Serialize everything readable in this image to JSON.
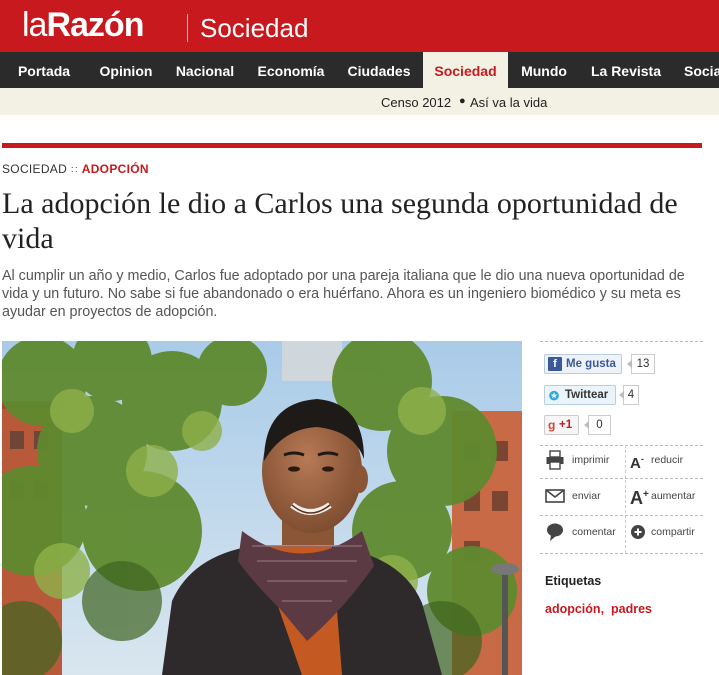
{
  "brand": {
    "logo_light": "la",
    "logo_bold": "Razón",
    "section": "Sociedad"
  },
  "nav": [
    {
      "label": "Portada",
      "active": false
    },
    {
      "label": "Opinion",
      "active": false
    },
    {
      "label": "Nacional",
      "active": false
    },
    {
      "label": "Economía",
      "active": false
    },
    {
      "label": "Ciudades",
      "active": false
    },
    {
      "label": "Sociedad",
      "active": true
    },
    {
      "label": "Mundo",
      "active": false
    },
    {
      "label": "La Revista",
      "active": false
    },
    {
      "label": "Socia",
      "active": false
    }
  ],
  "subnav": {
    "item1": "Censo 2012",
    "item2": "Así va la vida"
  },
  "breadcrumb": {
    "section": "SOCIEDAD",
    "category": "ADOPCIÓN"
  },
  "article": {
    "headline": "La adopción le dio a Carlos una segunda oportunidad de vida",
    "lead": "Al cumplir un año y medio, Carlos fue adoptado por una pareja italiana que le dio una nueva oportunidad de vida y un futuro. No sabe si fue abandonado o era huérfano. Ahora es un ingeniero biomédico y su meta es ayudar en proyectos de adopción."
  },
  "social": {
    "facebook_label": "Me gusta",
    "facebook_count": "13",
    "twitter_label": "Twittear",
    "twitter_count": "4",
    "gplus_label": "+1",
    "gplus_count": "0"
  },
  "tools": {
    "print": "imprimir",
    "smaller": "reducir",
    "send": "enviar",
    "bigger": "aumentar",
    "comment": "comentar",
    "share": "compartir"
  },
  "tags": {
    "title": "Etiquetas",
    "tag1": "adopción",
    "tag2": "padres"
  },
  "colors": {
    "brand_red": "#c8191f",
    "nav_dark": "#2b2b2b",
    "subnav_bg": "#f2f1e4"
  }
}
